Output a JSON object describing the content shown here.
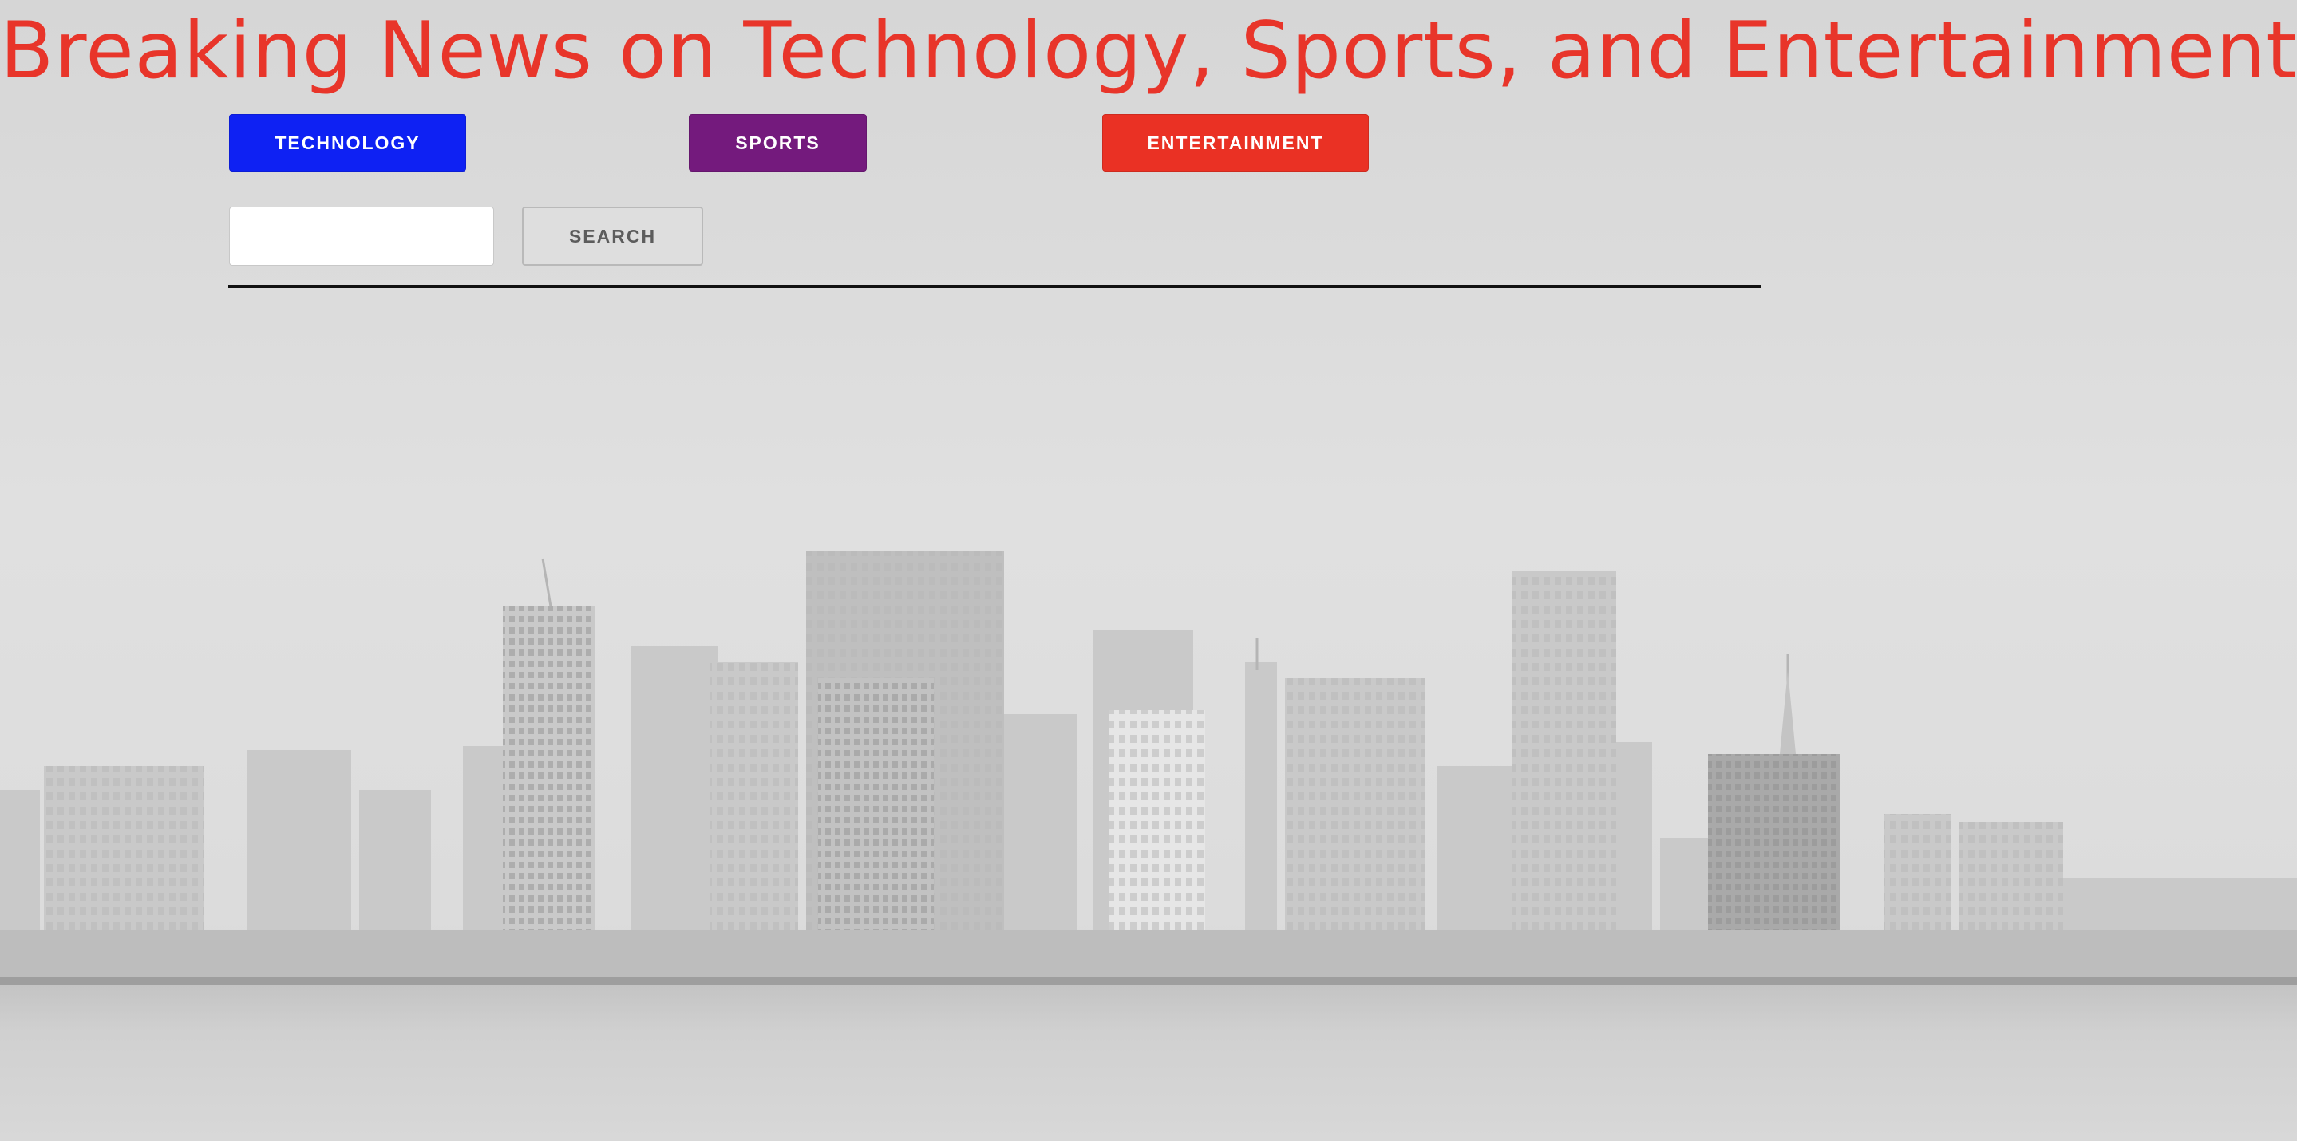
{
  "header": {
    "title": "Breaking News on Technology, Sports, and Entertainment",
    "title_color": "#e8352a"
  },
  "nav": {
    "buttons": [
      {
        "label": "TECHNOLOGY",
        "color": "#0e21f3"
      },
      {
        "label": "SPORTS",
        "color": "#741a7d"
      },
      {
        "label": "ENTERTAINMENT",
        "color": "#ea3124"
      }
    ]
  },
  "search": {
    "value": "",
    "placeholder": "",
    "button_label": "SEARCH"
  },
  "background": {
    "description_icon": "city-skyline-image"
  }
}
